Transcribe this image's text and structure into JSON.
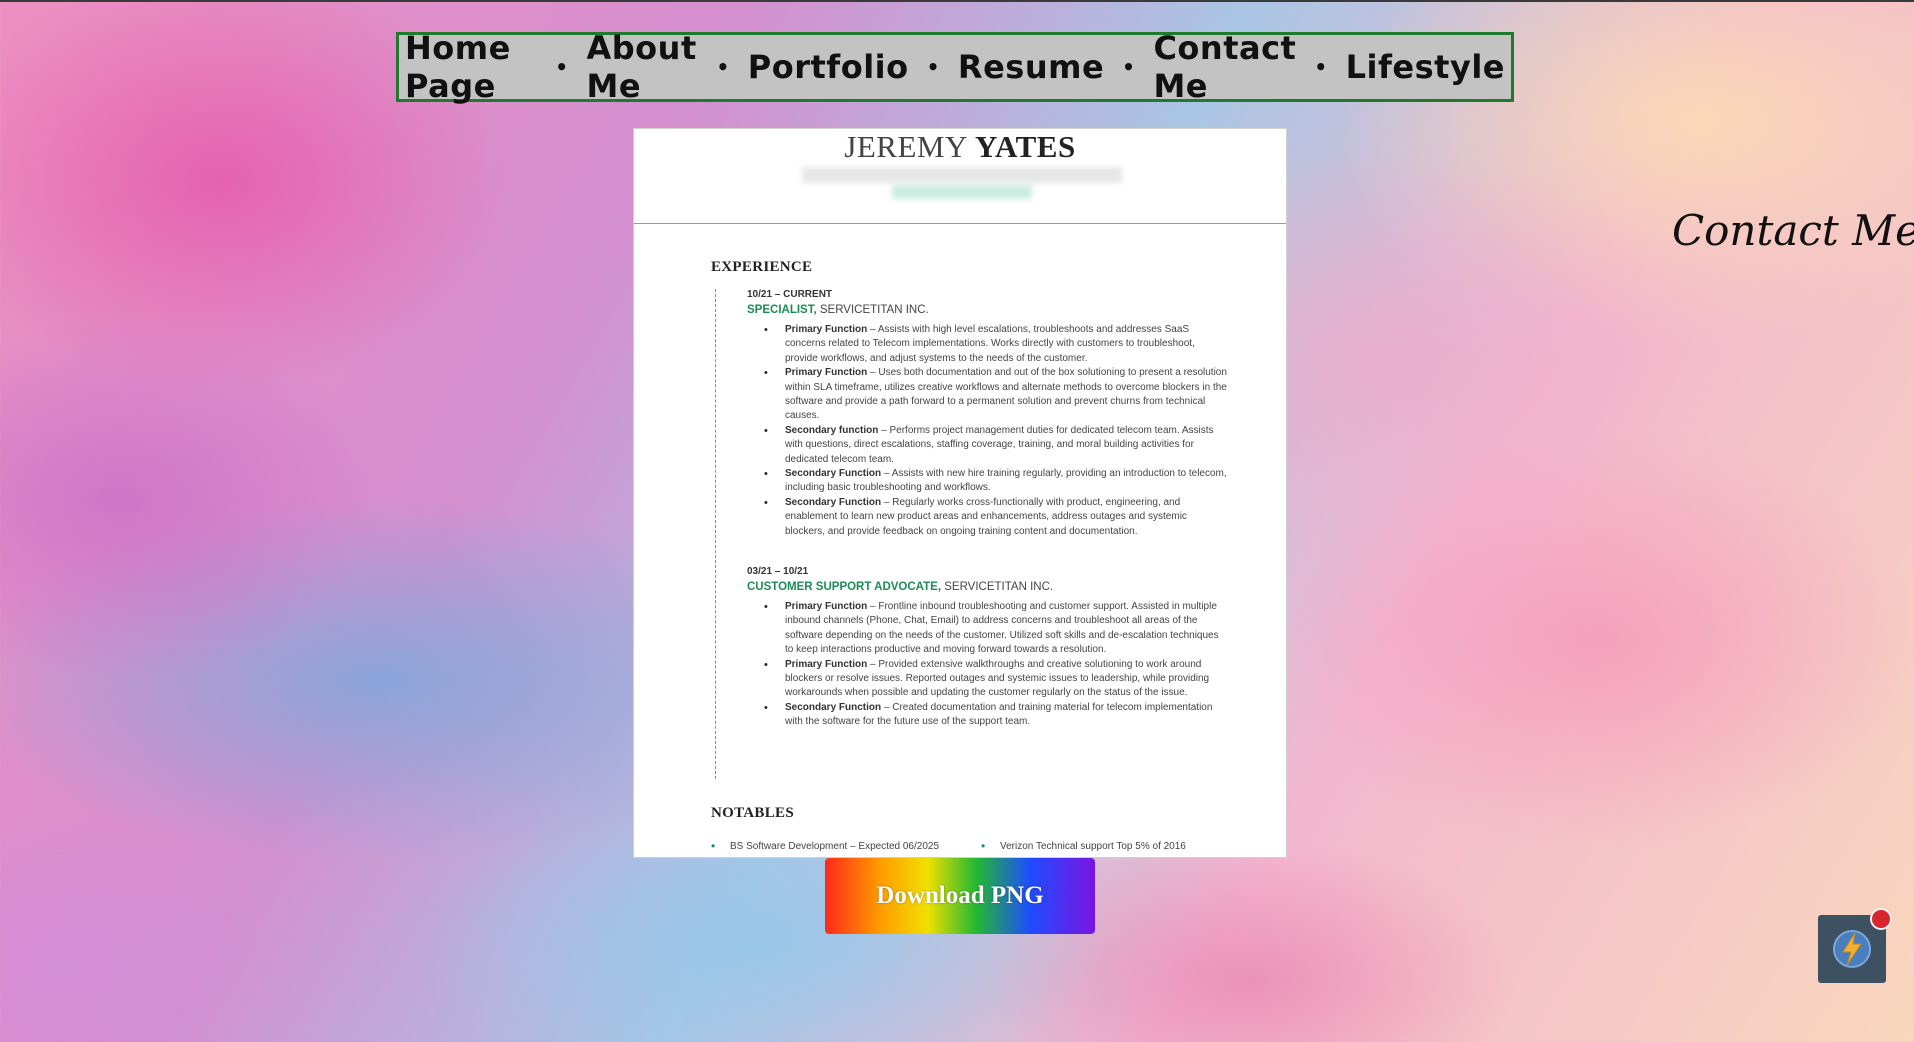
{
  "nav": {
    "items": [
      "Home Page",
      "About Me",
      "Portfolio",
      "Resume",
      "Contact Me",
      "Lifestyle"
    ],
    "separator": "•"
  },
  "resume": {
    "first_name": "JEREMY",
    "last_name": "YATES",
    "experience_title": "EXPERIENCE",
    "jobs": [
      {
        "date": "10/21 – CURRENT",
        "role": "SPECIALIST,",
        "company": "SERVICETITAN INC.",
        "bullets": [
          {
            "label": "Primary Function",
            "text": " – Assists with high level escalations, troubleshoots and addresses SaaS concerns related to Telecom implementations. Works directly with customers to troubleshoot, provide workflows, and adjust systems to the needs of the customer."
          },
          {
            "label": "Primary Function",
            "text": " – Uses both documentation and out of the box solutioning to present a resolution within SLA timeframe, utilizes creative workflows and alternate methods to overcome blockers in the software and provide a path forward to a permanent solution and prevent churns from technical causes."
          },
          {
            "label": "Secondary function",
            "text": " – Performs project management duties for dedicated telecom team. Assists with questions, direct escalations, staffing coverage, training, and moral building activities for dedicated telecom team."
          },
          {
            "label": "Secondary Function",
            "text": " – Assists with new hire training regularly, providing an introduction to telecom, including basic troubleshooting and workflows."
          },
          {
            "label": "Secondary Function",
            "text": " – Regularly works cross-functionally with product, engineering, and enablement to learn new product areas and enhancements, address outages and systemic blockers, and provide feedback on ongoing training content and documentation."
          }
        ]
      },
      {
        "date": "03/21 – 10/21",
        "role": "CUSTOMER SUPPORT ADVOCATE,",
        "company": "SERVICETITAN INC.",
        "bullets": [
          {
            "label": "Primary Function",
            "text": " – Frontline inbound troubleshooting and customer support. Assisted in multiple inbound channels (Phone, Chat, Email) to address concerns and troubleshoot all areas of the software depending on the needs of the customer. Utilized soft skills and de-escalation techniques to keep interactions productive and moving forward towards a resolution."
          },
          {
            "label": "Primary Function",
            "text": " – Provided extensive walkthroughs and creative solutioning to work around blockers or resolve issues. Reported outages and systemic issues to leadership, while providing workarounds when possible and updating the customer regularly on the status of the issue."
          },
          {
            "label": "Secondary Function",
            "text": " – Created documentation and training material for telecom implementation with the software for the future use of the support team."
          }
        ]
      }
    ],
    "notables_title": "NOTABLES",
    "notables": [
      "BS Software Development – Expected 06/2025",
      "Verizon Technical support Top 5% of 2016"
    ]
  },
  "download_label": "Download PNG",
  "contact_text": "Contact Me To",
  "colors": {
    "nav_border": "#1f7a2e",
    "nav_bg": "#c3c3c3",
    "resume_accent": "#1e8a5a",
    "widget_bg": "#3e5163",
    "badge": "#d8262c"
  },
  "icons": {
    "widget": "lightning-bolt-icon"
  }
}
